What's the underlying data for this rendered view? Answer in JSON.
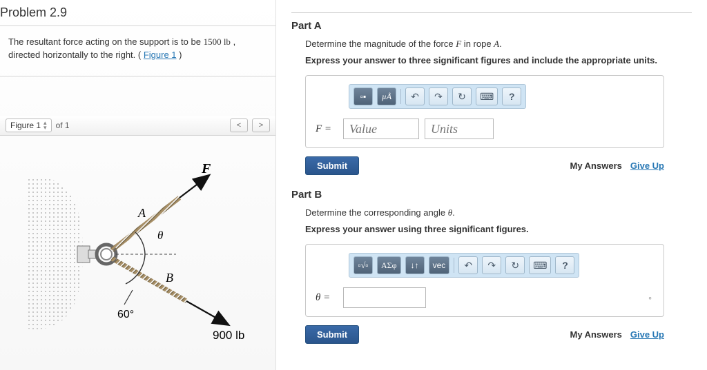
{
  "left": {
    "title": "Problem 2.9",
    "desc_prefix": "The resultant force acting on the support is to be ",
    "desc_value": "1500 lb",
    "desc_mid": " , directed horizontally to the right. (",
    "figure_link": "Figure 1",
    "desc_suffix": ")",
    "figure_selector": "Figure 1",
    "figure_of": "of 1",
    "diagram": {
      "F_label": "F",
      "A_label": "A",
      "B_label": "B",
      "theta_label": "θ",
      "angle_text": "60°",
      "force_text": "900 lb"
    }
  },
  "partA": {
    "title": "Part A",
    "prompt_pre": "Determine the magnitude of the force ",
    "prompt_F": "F",
    "prompt_mid": " in rope ",
    "prompt_A": "A",
    "prompt_post": ".",
    "instruction": "Express your answer to three significant figures and include the appropriate units.",
    "toolbar": {
      "templates": "▫▪",
      "units": "µÅ",
      "undo": "↶",
      "redo": "↷",
      "reset": "↻",
      "keyboard": "⌨",
      "help": "?"
    },
    "eq_label": "F =",
    "value_ph": "Value",
    "units_ph": "Units",
    "submit": "Submit",
    "my_answers": "My Answers",
    "give_up": "Give Up"
  },
  "partB": {
    "title": "Part B",
    "prompt_pre": "Determine the corresponding angle ",
    "prompt_theta": "θ",
    "prompt_post": ".",
    "instruction": "Express your answer using three significant figures.",
    "toolbar": {
      "templates": "▫√▫",
      "greek": "ΑΣφ",
      "subscript": "↓↑",
      "vec": "vec",
      "undo": "↶",
      "redo": "↷",
      "reset": "↻",
      "keyboard": "⌨",
      "help": "?"
    },
    "eq_label": "θ =",
    "degree_hint": "∘",
    "submit": "Submit",
    "my_answers": "My Answers",
    "give_up": "Give Up"
  },
  "chart_data": {
    "type": "diagram",
    "description": "Free-body diagram of a ring bolted to a wall. Rope A extends up-right at angle θ above horizontal carrying force F. Rope B extends down-right at 60° below horizontal carrying 900 lb. Resultant must be 1500 lb horizontal to the right.",
    "known": {
      "rope_B_force_lb": 900,
      "rope_B_angle_deg_below_horizontal": 60,
      "resultant_lb": 1500,
      "resultant_direction": "horizontal right"
    },
    "unknowns": [
      "F (magnitude in rope A)",
      "θ (angle of rope A above horizontal)"
    ]
  }
}
